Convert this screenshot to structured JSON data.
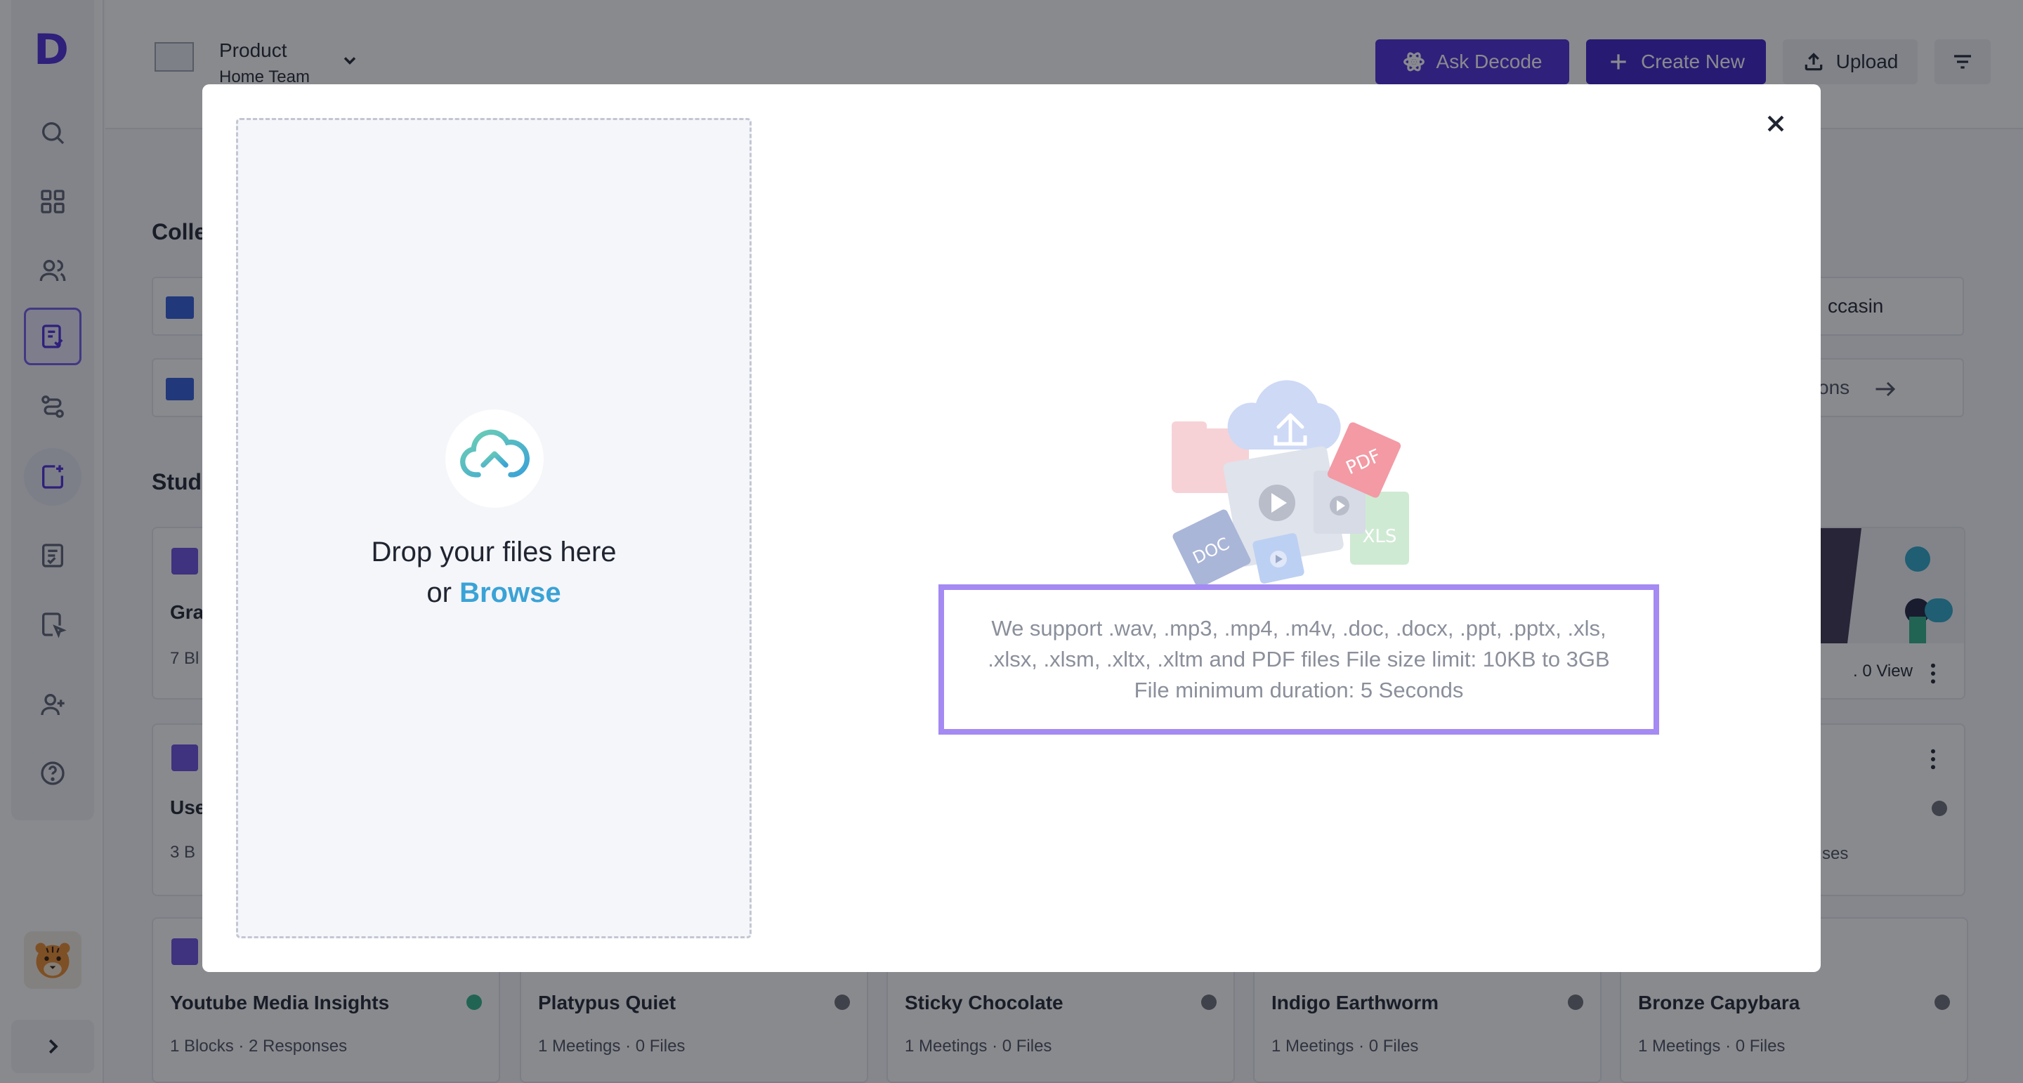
{
  "app": {
    "logo_letter": "D"
  },
  "header": {
    "team_name": "Product",
    "team_subtitle": "Home Team",
    "ask_label": "Ask Decode",
    "create_label": "Create New",
    "upload_label": "Upload"
  },
  "background": {
    "collections_title": "Colle",
    "studies_title": "Stud",
    "collection_row1_text": "ccasin",
    "collection_row2_text": "ons",
    "cards": [
      {
        "title": "Gra",
        "meta": "7 Bl"
      },
      {
        "title": "Use",
        "meta": "3 B"
      }
    ],
    "right_card_meta": ". 0 View",
    "right_card2_meta": "ses",
    "bottom_cards": [
      {
        "title": "Youtube Media Insights",
        "meta": "1 Blocks · 2 Responses",
        "status_color": "#2fb38a"
      },
      {
        "title": "Platypus Quiet",
        "meta": "1 Meetings · 0 Files",
        "status_color": "#6b6f78"
      },
      {
        "title": "Sticky Chocolate",
        "meta": "1 Meetings · 0 Files",
        "status_color": "#6b6f78"
      },
      {
        "title": "Indigo Earthworm",
        "meta": "1 Meetings · 0 Files",
        "status_color": "#6b6f78"
      },
      {
        "title": "Bronze Capybara",
        "meta": "1 Meetings · 0 Files",
        "status_color": "#6b6f78"
      }
    ]
  },
  "modal": {
    "drop_text": "Drop your files here",
    "or_text": "or",
    "browse_label": "Browse",
    "support_text": "We support .wav, .mp3, .mp4, .m4v, .doc, .docx, .ppt, .pptx, .xls, .xlsx, .xlsm, .xltx, .xltm and PDF files File size limit: 10KB to 3GB File minimum duration: 5 Seconds",
    "illustration_labels": {
      "pdf": "PDF",
      "doc": "DOC",
      "xls": "XLS"
    }
  },
  "colors": {
    "brand": "#4b2bd8",
    "accent_highlight": "#a48af2",
    "browse_link": "#3aa3d6"
  }
}
